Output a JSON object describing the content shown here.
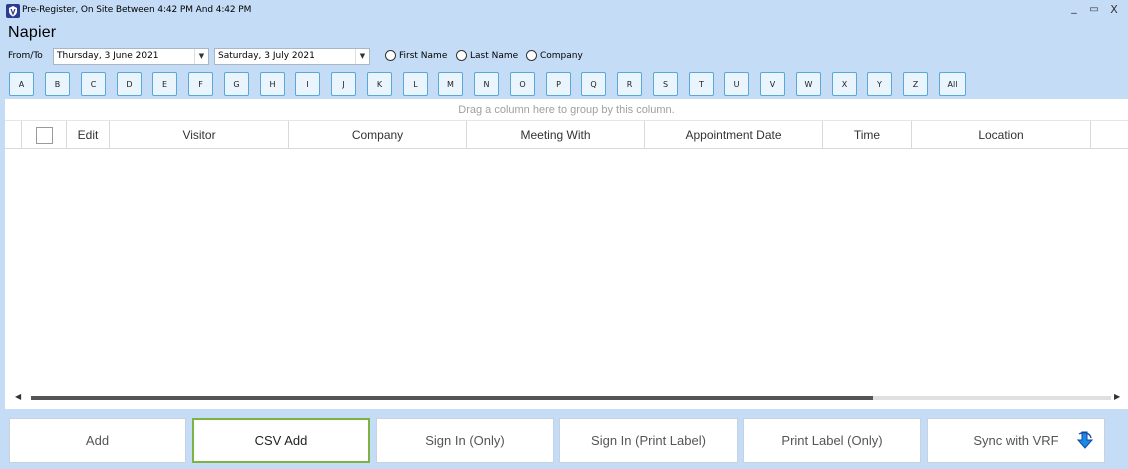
{
  "window": {
    "title": "Pre-Register, On Site Between 4:42 PM And 4:42 PM",
    "icon": "app-shield-icon",
    "controls": {
      "minimize": "_",
      "maximize": "▭",
      "close": "X"
    }
  },
  "site": {
    "name": "Napier"
  },
  "filters": {
    "range_label": "From/To",
    "date_from": "Thursday, 3 June 2021",
    "date_to": "Saturday, 3 July 2021",
    "search_by": [
      "First Name",
      "Last Name",
      "Company"
    ]
  },
  "letters": [
    "A",
    "B",
    "C",
    "D",
    "E",
    "F",
    "G",
    "H",
    "I",
    "J",
    "K",
    "L",
    "M",
    "N",
    "O",
    "P",
    "Q",
    "R",
    "S",
    "T",
    "U",
    "V",
    "W",
    "X",
    "Y",
    "Z",
    "All"
  ],
  "grid": {
    "group_hint": "Drag a column here to group by this column.",
    "columns": [
      "",
      "Edit",
      "Visitor",
      "Company",
      "Meeting With",
      "Appointment Date",
      "Time",
      "Location"
    ],
    "rows": [],
    "scroll_fraction_visible": 0.78
  },
  "actions": {
    "add": "Add",
    "csv_add": "CSV Add",
    "sign_in_only": "Sign In (Only)",
    "sign_in_print": "Sign In (Print Label)",
    "print_label_only": "Print Label (Only)",
    "sync_vrf": "Sync with VRF"
  },
  "colors": {
    "background": "#c4dcf6",
    "letter_border": "#58a8da",
    "active_border": "#7cb342",
    "sync_icon": "#1e88e5"
  }
}
